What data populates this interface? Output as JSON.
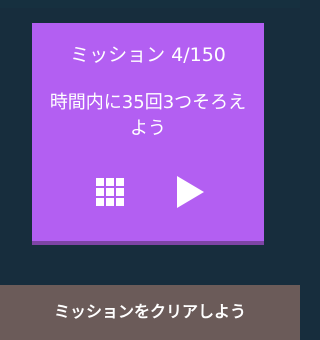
{
  "mission_card": {
    "title": "ミッション 4/150",
    "description": "時間内に35回3つそろえよう",
    "level_grid_icon": "grid-icon",
    "play_icon": "play-icon"
  },
  "footer": {
    "text": "ミッションをクリアしよう"
  },
  "colors": {
    "background": "#172d3d",
    "card": "#b35ff2",
    "card_bottom": "#7e44a6",
    "footer": "#6b5b59"
  }
}
